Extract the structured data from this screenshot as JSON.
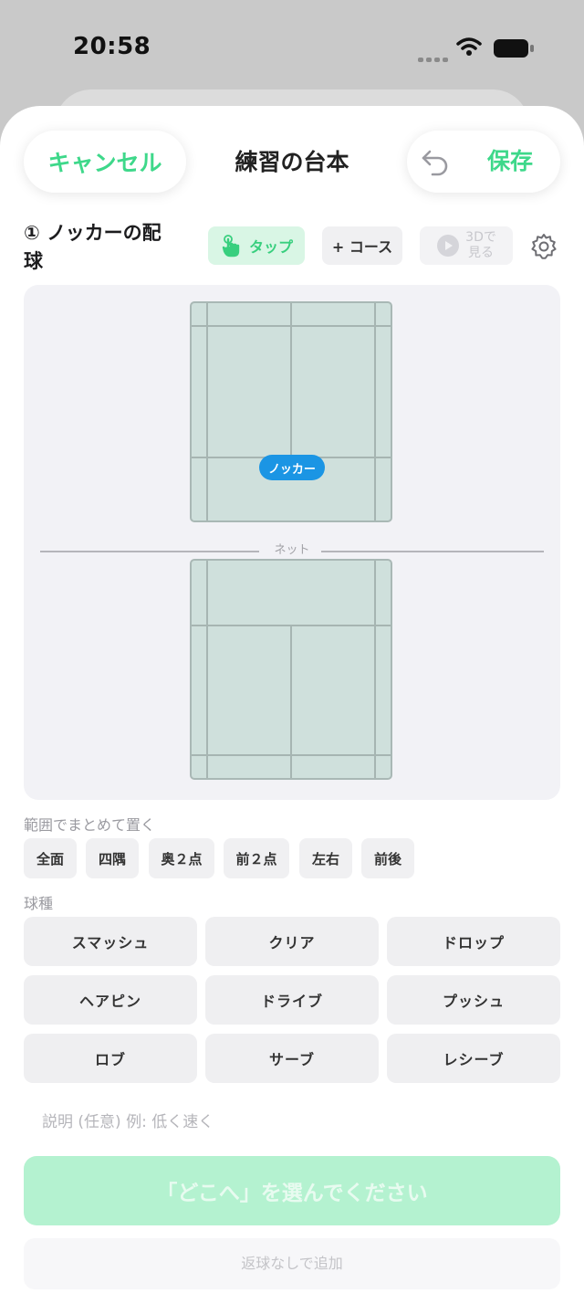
{
  "status_bar": {
    "time": "20:58"
  },
  "header": {
    "cancel_label": "キャンセル",
    "title": "練習の台本",
    "save_label": "保存"
  },
  "step": {
    "title": "① ノッカーの配球",
    "chips": {
      "tap_label": "タップ",
      "course_label": "+ コース",
      "view3d_label_line1": "3Dで",
      "view3d_label_line2": "見る"
    }
  },
  "court": {
    "knocker_label": "ノッカー",
    "net_label": "ネット",
    "court_color": "#cfe0dc",
    "knocker_color": "#1b95e4"
  },
  "range": {
    "label": "範囲でまとめて置く",
    "buttons": [
      "全面",
      "四隅",
      "奥２点",
      "前２点",
      "左右",
      "前後"
    ]
  },
  "shot_types": {
    "label": "球種",
    "buttons": [
      "スマッシュ",
      "クリア",
      "ドロップ",
      "ヘアピン",
      "ドライブ",
      "プッシュ",
      "ロブ",
      "サーブ",
      "レシーブ"
    ]
  },
  "description": {
    "placeholder": "説明 (任意) 例: 低く速く"
  },
  "actions": {
    "primary_label": "「どこへ」を選んでください",
    "secondary_label": "返球なしで追加"
  },
  "colors": {
    "accent": "#3ed88a",
    "primary_disabled": "#b4f2d0"
  }
}
